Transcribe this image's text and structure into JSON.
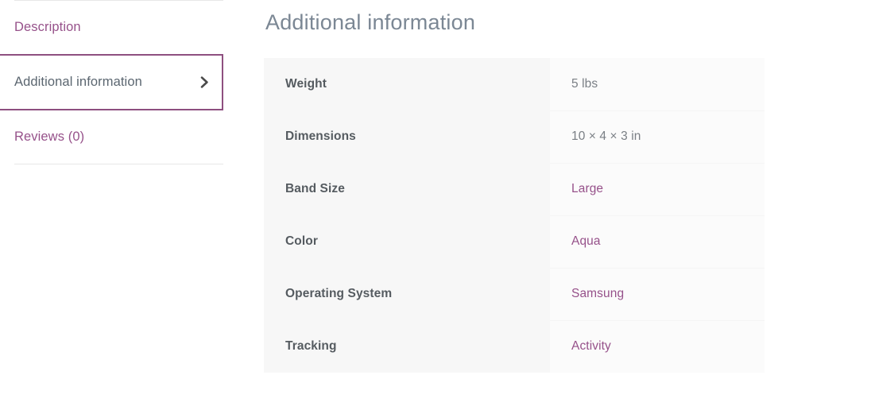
{
  "theme": {
    "accent": "#96518a",
    "accent_border": "#8e4f80",
    "label_text": "#555b60",
    "value_text": "#7a7f85",
    "title_text": "#7b8794",
    "label_cell_bg": "#f7f7f7",
    "value_cell_bg": "#fbfbfb",
    "divider": "#e8e8e8"
  },
  "tabs": {
    "items": [
      {
        "id": "description",
        "label": "Description",
        "active": false,
        "icon": ""
      },
      {
        "id": "additional-information",
        "label": "Additional information",
        "active": true,
        "icon": "chevron-right-icon"
      },
      {
        "id": "reviews",
        "label": "Reviews (0)",
        "active": false,
        "icon": ""
      }
    ]
  },
  "main": {
    "title": "Additional information",
    "table": {
      "rows": [
        {
          "label": "Weight",
          "value": "5 lbs",
          "is_link": false
        },
        {
          "label": "Dimensions",
          "value": "10 × 4 × 3 in",
          "is_link": false
        },
        {
          "label": "Band Size",
          "value": "Large",
          "is_link": true
        },
        {
          "label": "Color",
          "value": "Aqua",
          "is_link": true
        },
        {
          "label": "Operating System",
          "value": "Samsung",
          "is_link": true
        },
        {
          "label": "Tracking",
          "value": "Activity",
          "is_link": true
        }
      ]
    }
  }
}
